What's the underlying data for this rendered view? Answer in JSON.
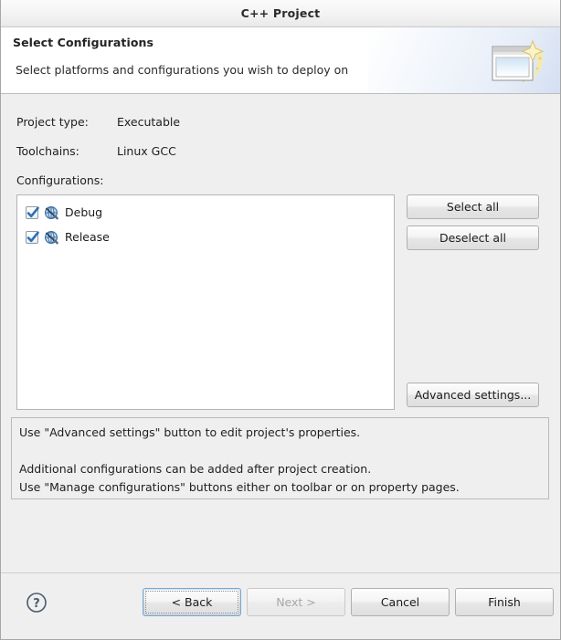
{
  "window": {
    "title": "C++ Project"
  },
  "header": {
    "title": "Select Configurations",
    "subtitle": "Select platforms and configurations you wish to deploy on",
    "icon": "new-project-wizard-icon"
  },
  "fields": [
    {
      "label": "Project type:",
      "value": "Executable"
    },
    {
      "label": "Toolchains:",
      "value": "Linux GCC"
    },
    {
      "label": "Configurations:",
      "value": ""
    }
  ],
  "configurations": {
    "items": [
      {
        "label": "Debug",
        "checked": true,
        "icon": "configuration-icon"
      },
      {
        "label": "Release",
        "checked": true,
        "icon": "configuration-icon"
      }
    ]
  },
  "side_buttons": {
    "select_all": "Select all",
    "deselect_all": "Deselect all",
    "advanced_settings": "Advanced settings..."
  },
  "description": {
    "line1": "Use \"Advanced settings\" button to edit project's properties.",
    "line2": "Additional configurations can be added after project creation.",
    "line3": "Use \"Manage configurations\" buttons either on toolbar or on property pages."
  },
  "footer": {
    "help": "help-icon",
    "back": "< Back",
    "next": "Next >",
    "cancel": "Cancel",
    "finish": "Finish"
  },
  "colors": {
    "dialog_bg": "#efefef",
    "list_bg": "#ffffff",
    "accent_focus": "#7aa8d4",
    "checkbox_check": "#2f6fb5",
    "text": "#1e1e1e",
    "disabled_text": "#a8a8a8"
  }
}
